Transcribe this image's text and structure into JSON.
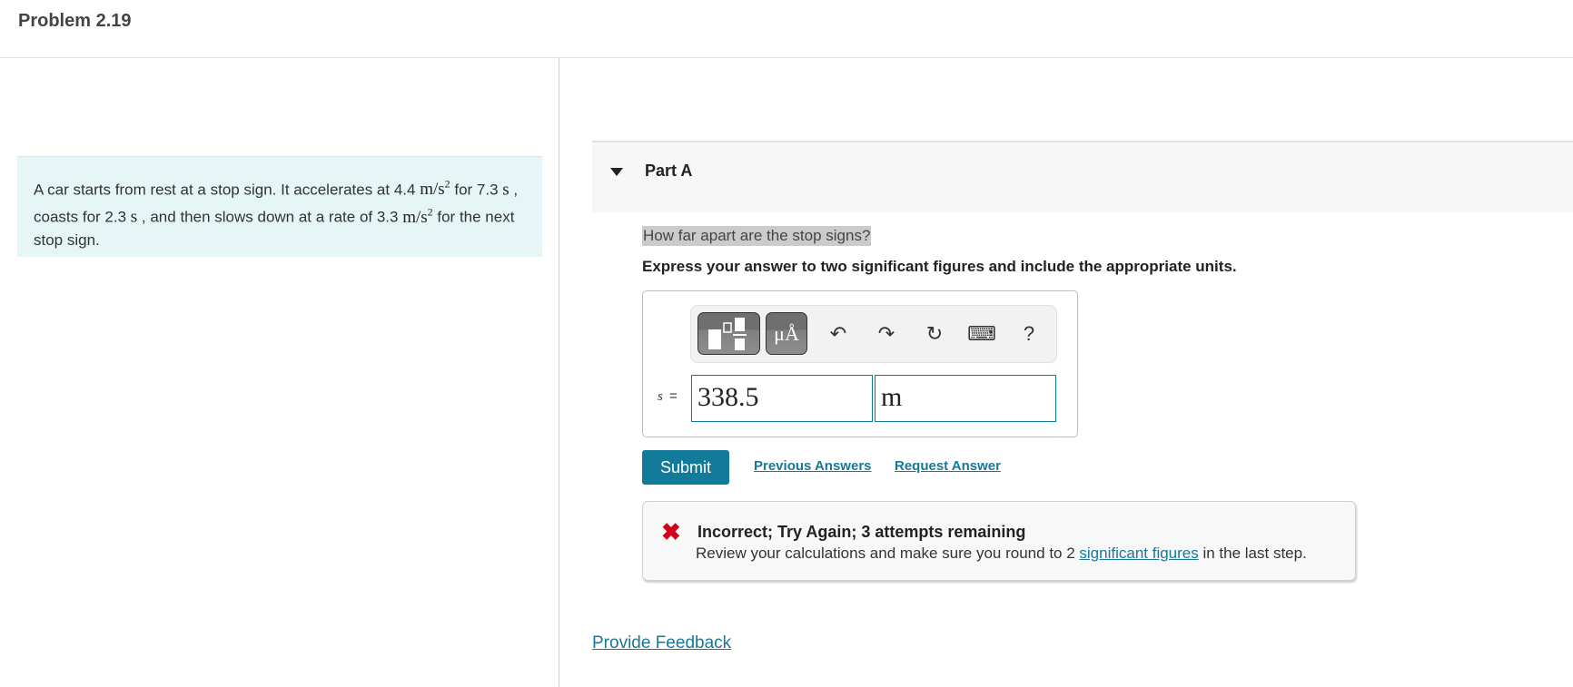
{
  "page": {
    "title": "Problem 2.19"
  },
  "problem": {
    "segments": [
      {
        "t": "A car starts from rest at a stop sign. It accelerates at 4.4 "
      },
      {
        "m": "m/s",
        "sup": "2"
      },
      {
        "t": " for 7.3 "
      },
      {
        "m": "s"
      },
      {
        "t": " , coasts for 2.3 "
      },
      {
        "m": "s"
      },
      {
        "t": " , and then slows down at a rate of 3.3 "
      },
      {
        "m": "m/s",
        "sup": "2"
      },
      {
        "t": " for the next stop sign."
      }
    ]
  },
  "part": {
    "title": "Part A",
    "question": "How far apart are the stop signs?",
    "instruction": "Express your answer to two significant figures and include the appropriate units."
  },
  "toolbar": {
    "units_label": "μÅ",
    "undo_icon": "↶",
    "redo_icon": "↷",
    "reset_icon": "↻",
    "keyboard_icon": "⌨",
    "help_icon": "?"
  },
  "answer": {
    "variable": "s",
    "equals": "=",
    "value": "338.5",
    "unit": "m"
  },
  "actions": {
    "submit": "Submit",
    "previous_answers": "Previous Answers",
    "request_answer": "Request Answer"
  },
  "feedback": {
    "icon": "✖",
    "title": "Incorrect; Try Again; 3 attempts remaining",
    "msg_before": "Review your calculations and make sure you round to 2 ",
    "msg_link": "significant figures",
    "msg_after": " in the last step."
  },
  "footer": {
    "provide_feedback": "Provide Feedback"
  },
  "colors": {
    "accent": "#137b9a",
    "link": "#17789a",
    "error": "#d4001b",
    "problem_bg": "#e6f5f6"
  }
}
